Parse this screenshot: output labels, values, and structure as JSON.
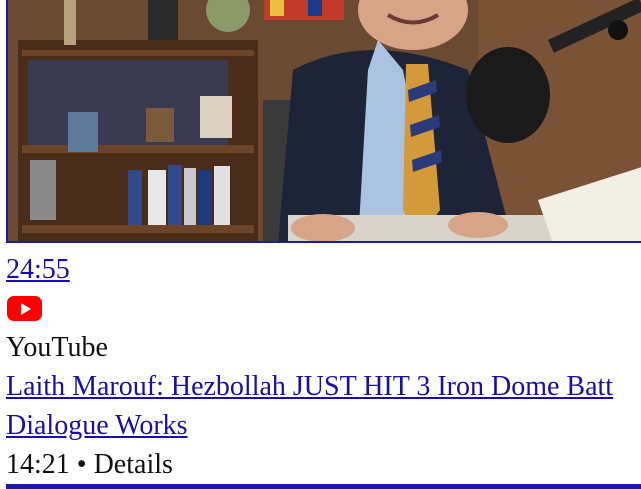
{
  "video": {
    "duration": "24:55",
    "source_icon": "youtube-logo-icon",
    "source": "YouTube",
    "title": "Laith Marouf: Hezbollah JUST HIT 3 Iron Dome Batt",
    "channel": "Dialogue Works",
    "meta": "14:21 • Details"
  },
  "colors": {
    "link": "#1a0dab",
    "border": "#1a1aa6",
    "youtube_red": "#ff0000"
  }
}
